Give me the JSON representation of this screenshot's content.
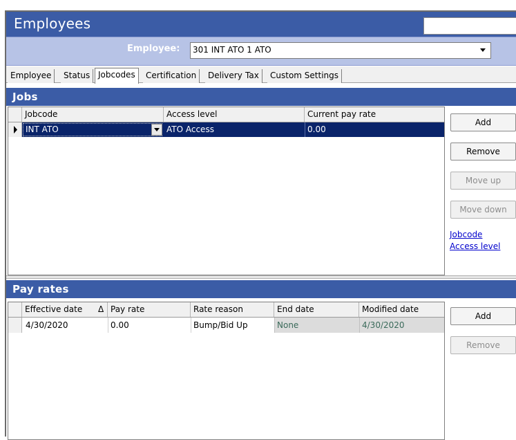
{
  "window": {
    "title": "Employees",
    "title_input_value": ""
  },
  "employee_selector": {
    "label": "Employee:",
    "value": "301 INT ATO 1 ATO"
  },
  "tabs": [
    {
      "label": "Employee",
      "active": false
    },
    {
      "label": "Status",
      "active": false
    },
    {
      "label": "Jobcodes",
      "active": true
    },
    {
      "label": "Certification",
      "active": false
    },
    {
      "label": "Delivery",
      "active": false
    },
    {
      "label": "Tax",
      "active": false
    },
    {
      "label": "Custom Settings",
      "active": false
    }
  ],
  "jobs": {
    "title": "Jobs",
    "columns": [
      "Jobcode",
      "Access level",
      "Current pay rate"
    ],
    "rows": [
      {
        "jobcode": "INT ATO",
        "access_level": "ATO Access",
        "pay_rate": "0.00",
        "selected": true
      }
    ],
    "buttons": {
      "add": "Add",
      "remove": "Remove",
      "move_up": "Move up",
      "move_down": "Move down"
    },
    "links": {
      "jobcode": "Jobcode",
      "access_level": "Access level"
    }
  },
  "pay_rates": {
    "title": "Pay rates",
    "columns": [
      "Effective date",
      "Pay rate",
      "Rate reason",
      "End date",
      "Modified date"
    ],
    "sort_indicator": "Δ",
    "rows": [
      {
        "effective_date": "4/30/2020",
        "pay_rate": "0.00",
        "rate_reason": "Bump/Bid Up",
        "end_date": "None",
        "modified_date": "4/30/2020"
      }
    ],
    "buttons": {
      "add": "Add",
      "remove": "Remove"
    }
  },
  "colors": {
    "header_blue": "#3b5ca6",
    "selector_band": "#b7c3e6",
    "selected_row": "#0a246a"
  }
}
